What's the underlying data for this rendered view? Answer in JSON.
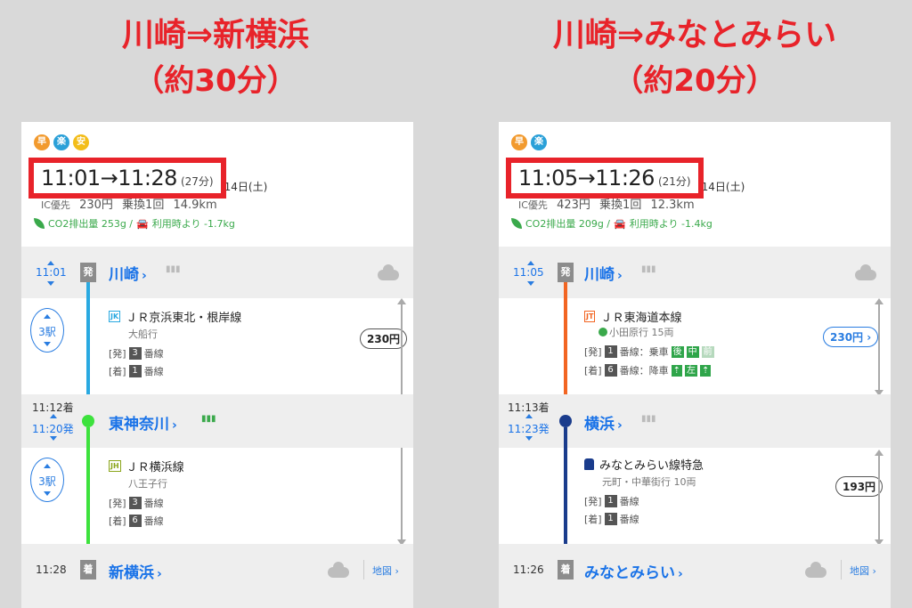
{
  "left": {
    "heading_line1": "川崎⇒新横浜",
    "heading_line2": "（約30分）",
    "badges": [
      "早",
      "楽",
      "安"
    ],
    "time_range": "11:01→11:28",
    "duration": "(27分)",
    "date": "6月14日(土)",
    "ic_label": "IC優先",
    "fare": "230円",
    "transfers": "乗換1回",
    "distance": "14.9km",
    "co2": "CO2排出量 253g /",
    "co2_compare": "利用時より -1.7kg",
    "origin": {
      "time": "11:01",
      "tag": "発",
      "name": "川崎",
      "arrow": "›"
    },
    "seg1": {
      "stops": "3駅",
      "code": "JK",
      "line": "ＪＲ京浜東北・根岸線",
      "dest": "大船行",
      "dep_label": "[発]",
      "dep_num": "3",
      "dep_suffix": "番線",
      "arr_label": "[着]",
      "arr_num": "1",
      "arr_suffix": "番線",
      "fare": "230円"
    },
    "transfer": {
      "arr_time": "11:12着",
      "dep_time": "11:20発",
      "name": "東神奈川",
      "arrow": "›"
    },
    "seg2": {
      "stops": "3駅",
      "code": "JH",
      "line": "ＪＲ横浜線",
      "dest": "八王子行",
      "dep_label": "[発]",
      "dep_num": "3",
      "dep_suffix": "番線",
      "arr_label": "[着]",
      "arr_num": "6",
      "arr_suffix": "番線"
    },
    "dest": {
      "time": "11:28",
      "tag": "着",
      "name": "新横浜",
      "arrow": "›",
      "map": "地図 ›"
    }
  },
  "right": {
    "heading_line1": "川崎⇒みなとみらい",
    "heading_line2": "（約20分）",
    "badges": [
      "早",
      "楽"
    ],
    "time_range": "11:05→11:26",
    "duration": "(21分)",
    "date": "6月14日(土)",
    "ic_label": "IC優先",
    "fare": "423円",
    "transfers": "乗換1回",
    "distance": "12.3km",
    "co2": "CO2排出量 209g /",
    "co2_compare": "利用時より -1.4kg",
    "origin": {
      "time": "11:05",
      "tag": "発",
      "name": "川崎",
      "arrow": "›"
    },
    "seg1": {
      "code": "JT",
      "line": "ＪＲ東海道本線",
      "dest": "小田原行 15両",
      "dep_label": "[発]",
      "dep_num": "1",
      "dep_suffix": "番線：乗車",
      "dep_cars": [
        "後",
        "中",
        "前"
      ],
      "arr_label": "[着]",
      "arr_num": "6",
      "arr_suffix": "番線：降車",
      "arr_cars": [
        "⇡",
        "左",
        "⇡"
      ],
      "fare": "230円 ›"
    },
    "transfer": {
      "arr_time": "11:13着",
      "dep_time": "11:23発",
      "name": "横浜",
      "arrow": "›"
    },
    "seg2": {
      "line": "みなとみらい線特急",
      "dest": "元町・中華街行 10両",
      "dep_label": "[発]",
      "dep_num": "1",
      "dep_suffix": "番線",
      "arr_label": "[着]",
      "arr_num": "1",
      "arr_suffix": "番線",
      "fare": "193円"
    },
    "dest": {
      "time": "11:26",
      "tag": "着",
      "name": "みなとみらい",
      "arrow": "›",
      "map": "地図 ›"
    }
  },
  "colors": {
    "accent_red": "#e8232a",
    "link_blue": "#1a73e8",
    "jk_line": "#29a9e1",
    "jh_line": "#3de23d",
    "jt_line": "#f26522",
    "mm_line": "#1a3c8c",
    "eco_green": "#3aa94b"
  }
}
